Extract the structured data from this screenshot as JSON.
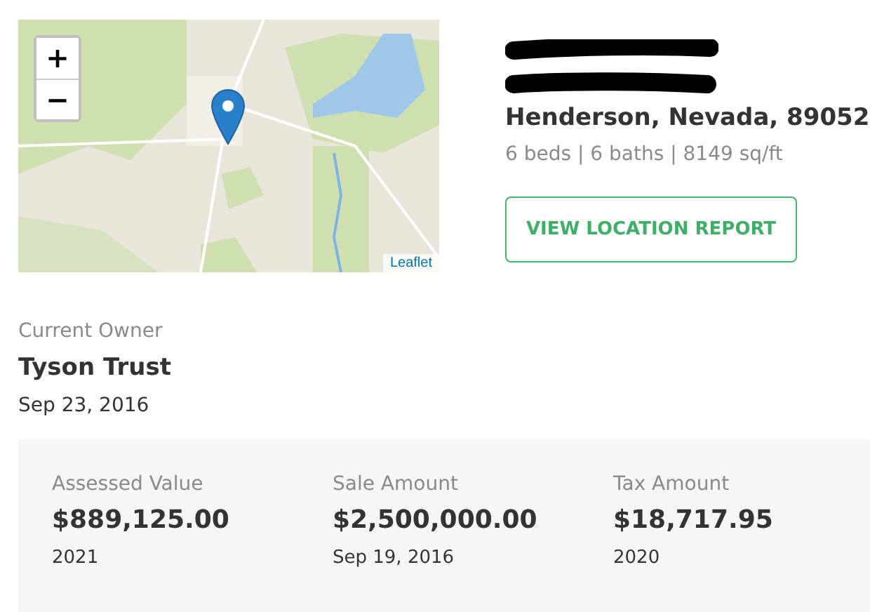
{
  "map": {
    "zoom_in": "+",
    "zoom_out": "−",
    "attribution": "Leaflet"
  },
  "property": {
    "address_redacted": true,
    "address": "Henderson, Nevada, 89052",
    "details": "6 beds | 6 baths | 8149 sq/ft",
    "report_button": "VIEW LOCATION REPORT"
  },
  "owner": {
    "label": "Current Owner",
    "name": "Tyson Trust",
    "date": "Sep 23, 2016"
  },
  "stats": [
    {
      "label": "Assessed Value",
      "value": "$889,125.00",
      "note": "2021"
    },
    {
      "label": "Sale Amount",
      "value": "$2,500,000.00",
      "note": "Sep 19, 2016"
    },
    {
      "label": "Tax Amount",
      "value": "$18,717.95",
      "note": "2020"
    }
  ]
}
